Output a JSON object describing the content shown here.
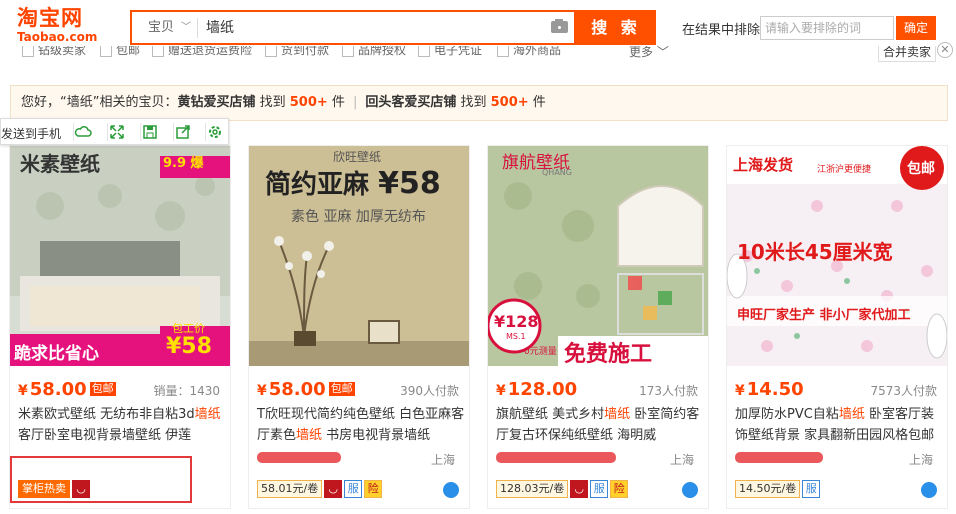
{
  "logo": {
    "cn": "淘宝网",
    "en": "Taobao.com"
  },
  "search": {
    "type": "宝贝",
    "query": "墙纸",
    "button": "搜 索"
  },
  "exclude": {
    "label": "在结果中排除",
    "placeholder": "请输入要排除的词",
    "button": "确定"
  },
  "filters": {
    "items": [
      "钻级卖家",
      "包邮",
      "赠送退货运费险",
      "货到付款",
      "品牌授权",
      "电子凭证",
      "海外商品"
    ],
    "more": "更多",
    "merge": "合并卖家"
  },
  "notice": {
    "prefix": "您好，“墙纸”相关的宝贝：",
    "shop1": "黄钻爱买店铺",
    "mid1": " 找到 ",
    "count1": "500+",
    "suffix1": " 件",
    "sep": "|",
    "shop2": "回头客爱买店铺",
    "mid2": " 找到 ",
    "count2": "500+",
    "suffix2": " 件"
  },
  "toolbar": {
    "label": "发送到手机"
  },
  "colors": {
    "accent": "#ff4400",
    "brand": "#ff5000"
  },
  "cards": [
    {
      "price": "58.00",
      "by": "包邮",
      "paid": "销量：1430",
      "title_a": "米素欧式壁纸 无纺布非自粘3d",
      "title_hl": "墙纸",
      "title_b": "客厅卧室电视背景墙壁纸 伊莲",
      "shop": "",
      "loc": "",
      "chips": [
        "掌柜热卖"
      ],
      "img_line1": "米素壁纸",
      "img_badge": "9.9 爆",
      "img_bottom": "跪求比省心",
      "img_price": "¥58",
      "img_pricetag": "包工价"
    },
    {
      "price": "58.00",
      "by": "包邮",
      "paid": "390人付款",
      "title_a": "T欣旺现代简约纯色壁纸 白色亚麻客厅素色",
      "title_hl": "墙纸",
      "title_b": " 书房电视背景墙纸",
      "shop": "",
      "loc": "上海",
      "chips": [
        "58.01元/卷"
      ],
      "img_line1": "欣旺壁纸",
      "img_line2": "简约亚麻",
      "img_price": "¥58",
      "img_sub": "素色 亚麻 加厚无纺布"
    },
    {
      "price": "128.00",
      "by": "",
      "paid": "173人付款",
      "title_a": "旗航壁纸 美式乡村",
      "title_hl": "墙纸",
      "title_b": " 卧室简约客厅复古环保纯纸壁纸 海明威",
      "shop": "",
      "loc": "上海",
      "chips": [
        "128.03元/卷"
      ],
      "img_line1": "旗航壁纸",
      "img_en": "QHANG",
      "img_price": "¥128",
      "img_ms": "MS.1",
      "img_free": "免费施工",
      "img_zero": "0元测量"
    },
    {
      "price": "14.50",
      "by": "",
      "paid": "7573人付款",
      "title_a": "加厚防水PVC自粘",
      "title_hl": "墙纸",
      "title_b": " 卧室客厅装饰壁纸背景 家具翻新田园风格包邮",
      "shop": "",
      "loc": "上海",
      "chips": [
        "14.50元/卷"
      ],
      "img_line1": "上海发货",
      "img_sub1": "江浙沪更便捷",
      "img_tag": "包邮",
      "img_big": "10米长45厘米宽",
      "img_bottom": "申旺厂家生产 非小厂家代加工"
    }
  ]
}
